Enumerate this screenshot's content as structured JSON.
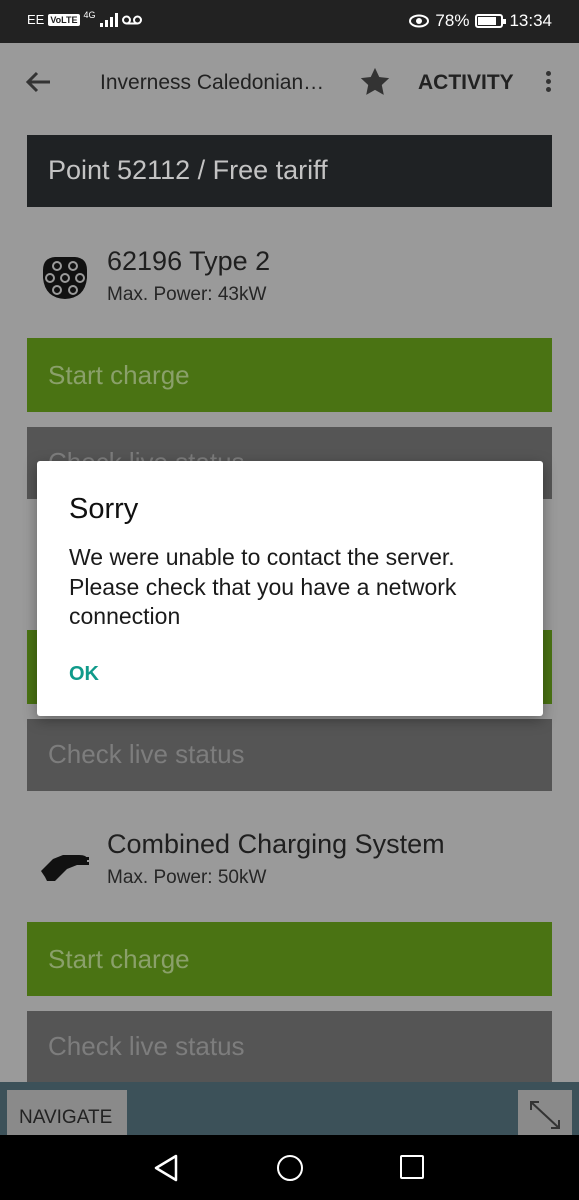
{
  "status_bar": {
    "carrier": "EE",
    "volte": "VoLTE",
    "network": "4G",
    "battery": "78%",
    "battery_level": 0.78,
    "time": "13:34"
  },
  "app_bar": {
    "title": "Inverness Caledonian…",
    "action": "ACTIVITY"
  },
  "point_header": "Point 52112 / Free tariff",
  "connectors": [
    {
      "name": "62196 Type 2",
      "power": "Max. Power: 43kW",
      "icon": "type2-connector-icon"
    },
    {
      "name": "Combined Charging System",
      "power": "Max. Power: 50kW",
      "icon": "ccs-connector-icon"
    }
  ],
  "buttons": {
    "start_charge": "Start charge",
    "check_live_status": "Check live status"
  },
  "bottom_bar": {
    "navigate": "NAVIGATE"
  },
  "dialog": {
    "title": "Sorry",
    "message": "We were unable to contact the server. Please check that you have a network connection",
    "ok": "OK"
  },
  "colors": {
    "accent": "#0f9a8a",
    "start_green": "#4a7313",
    "header_dark": "#1f2224"
  }
}
